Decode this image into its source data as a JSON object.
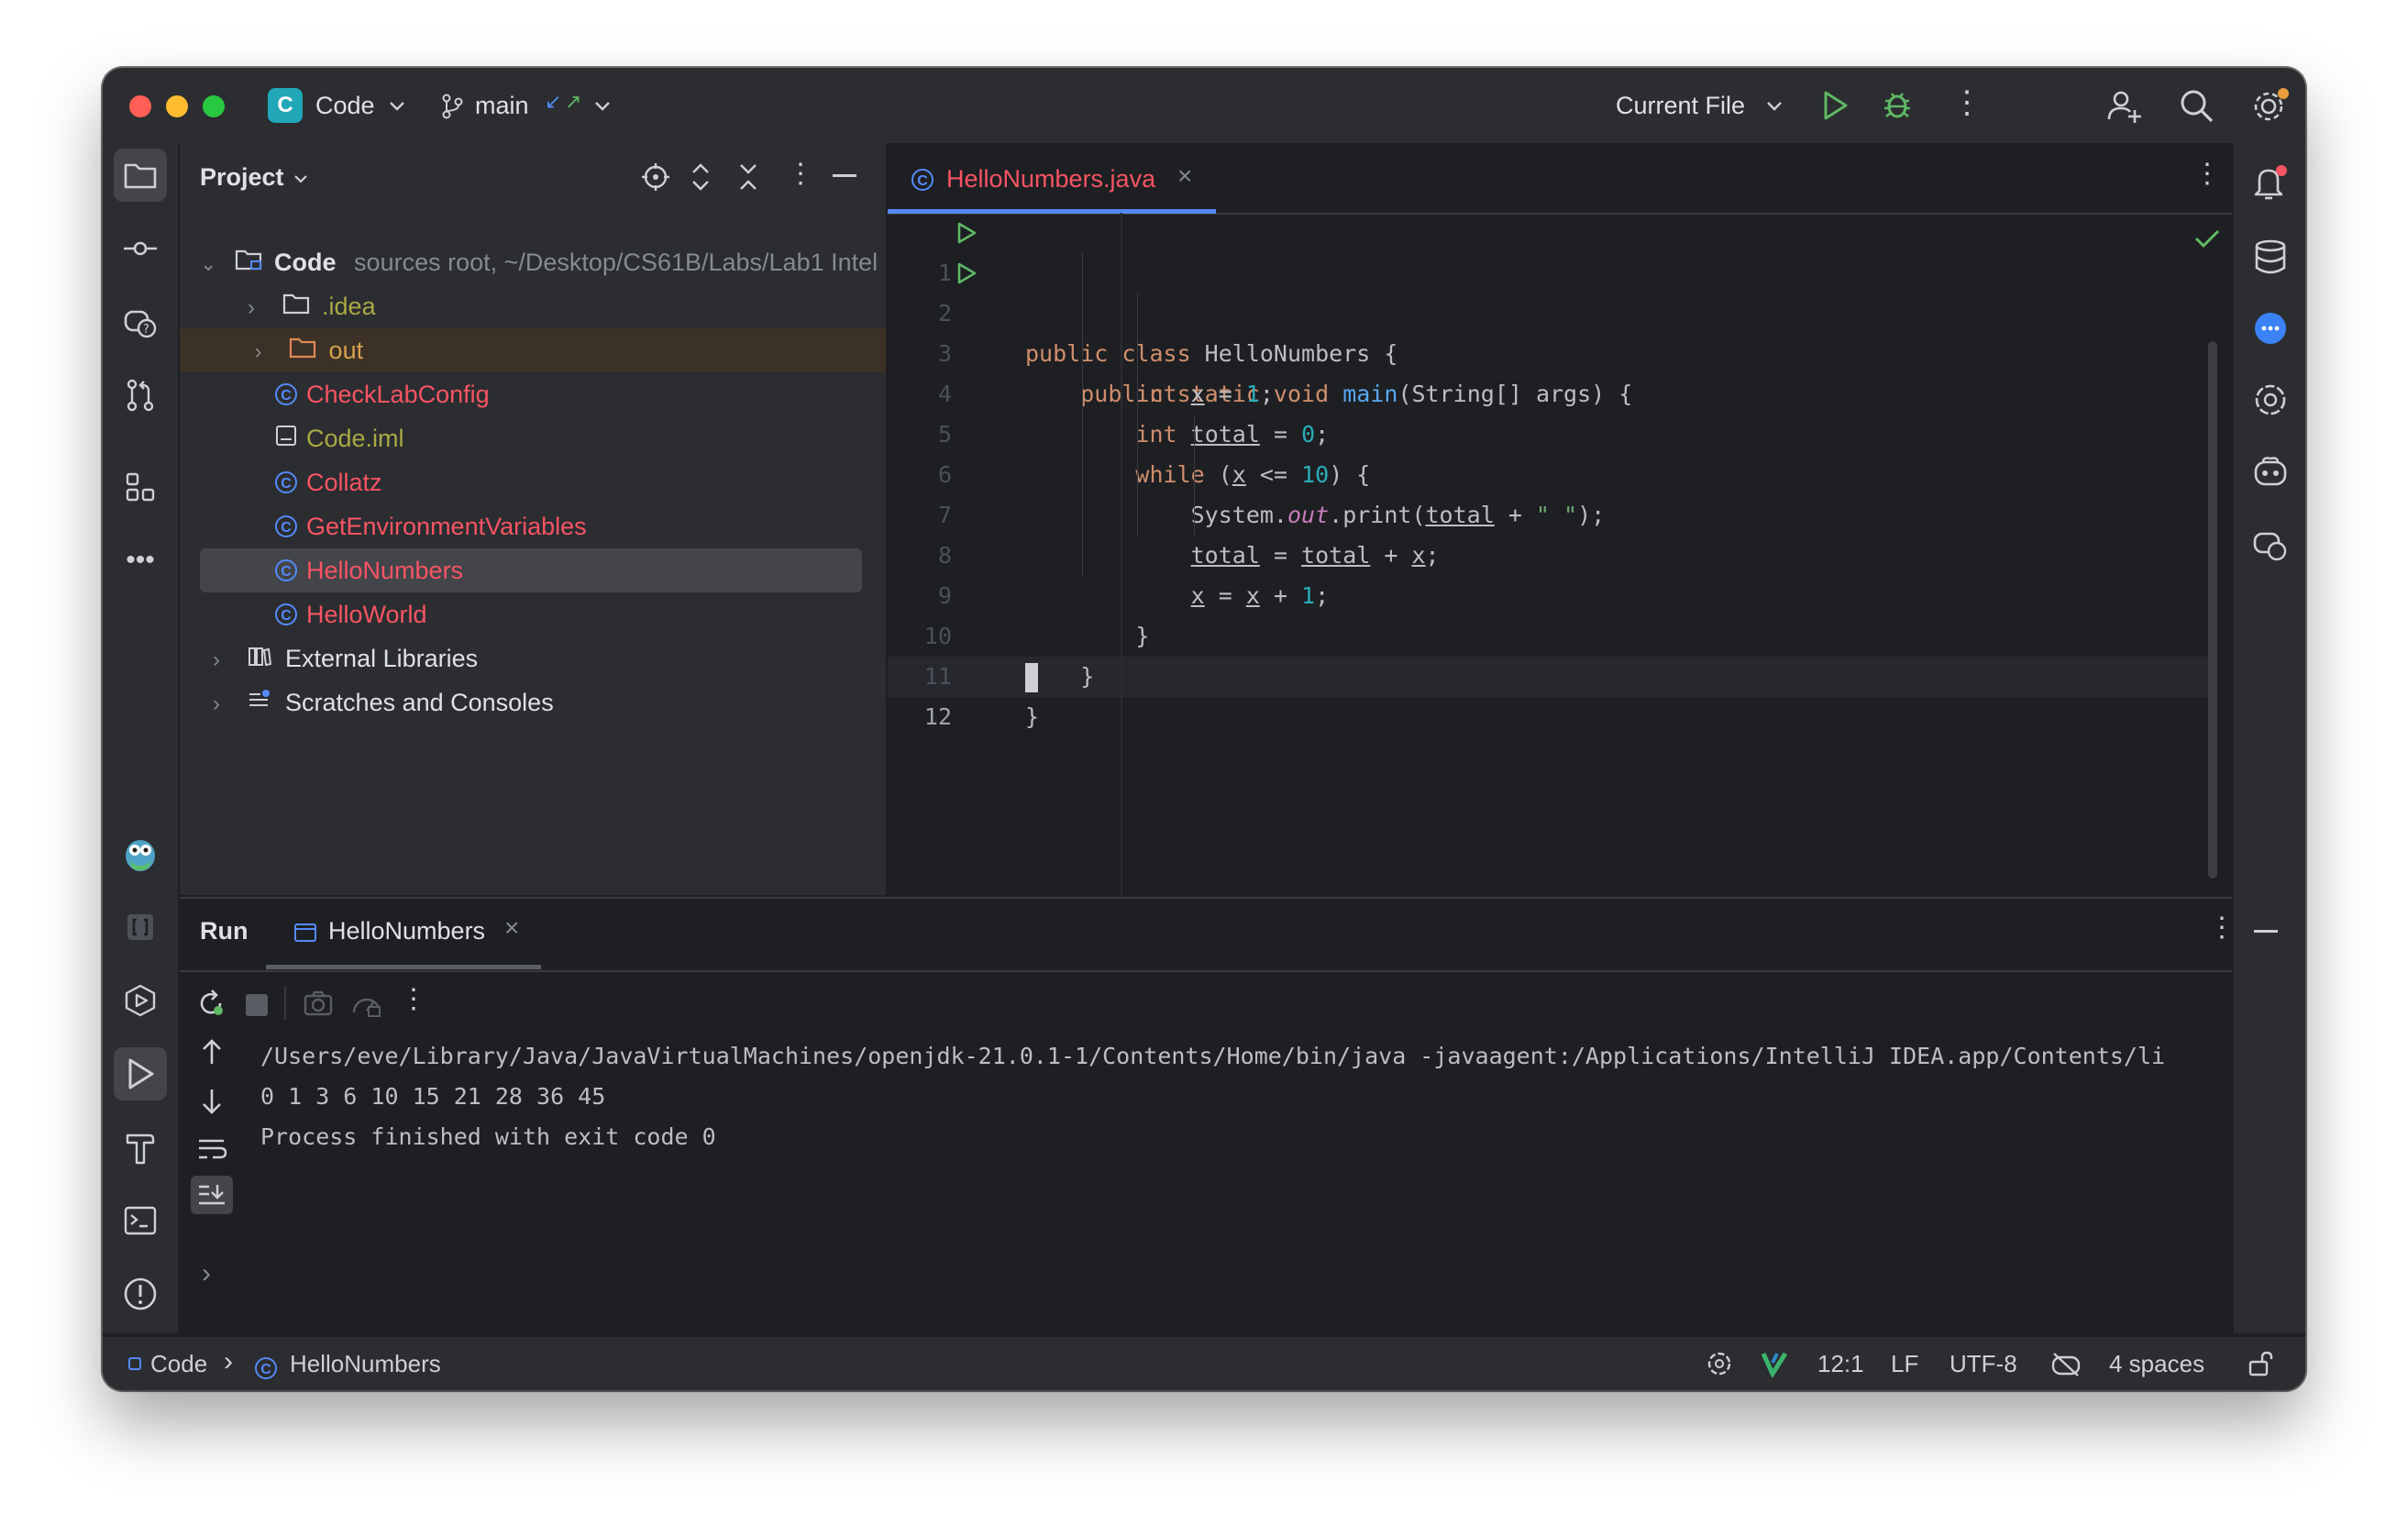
{
  "titlebar": {
    "project_badge": "C",
    "project_name": "Code",
    "branch": "main",
    "run_config": "Current File"
  },
  "project_panel": {
    "title": "Project",
    "items": [
      {
        "label": "Code",
        "meta": "sources root,  ~/Desktop/CS61B/Labs/Lab1 Intel"
      },
      {
        "label": ".idea"
      },
      {
        "label": "out"
      },
      {
        "label": "CheckLabConfig"
      },
      {
        "label": "Code.iml"
      },
      {
        "label": "Collatz"
      },
      {
        "label": "GetEnvironmentVariables"
      },
      {
        "label": "HelloNumbers"
      },
      {
        "label": "HelloWorld"
      },
      {
        "label": "External Libraries"
      },
      {
        "label": "Scratches and Consoles"
      }
    ]
  },
  "editor": {
    "tab_label": "HelloNumbers.java",
    "line_numbers": [
      "1",
      "2",
      "3",
      "4",
      "5",
      "6",
      "7",
      "8",
      "9",
      "10",
      "11",
      "12"
    ]
  },
  "run_panel": {
    "title": "Run",
    "tab_label": "HelloNumbers",
    "console_lines": [
      "/Users/eve/Library/Java/JavaVirtualMachines/openjdk-21.0.1-1/Contents/Home/bin/java -javaagent:/Applications/IntelliJ IDEA.app/Contents/li",
      "0 1 3 6 10 15 21 28 36 45",
      "Process finished with exit code 0"
    ]
  },
  "statusbar": {
    "crumb_project": "Code",
    "crumb_file": "HelloNumbers",
    "position": "12:1",
    "line_sep": "LF",
    "encoding": "UTF-8",
    "indent": "4 spaces"
  },
  "colors": {
    "accent": "#548af7",
    "error_red": "#f75464",
    "run_green": "#5fb865"
  }
}
